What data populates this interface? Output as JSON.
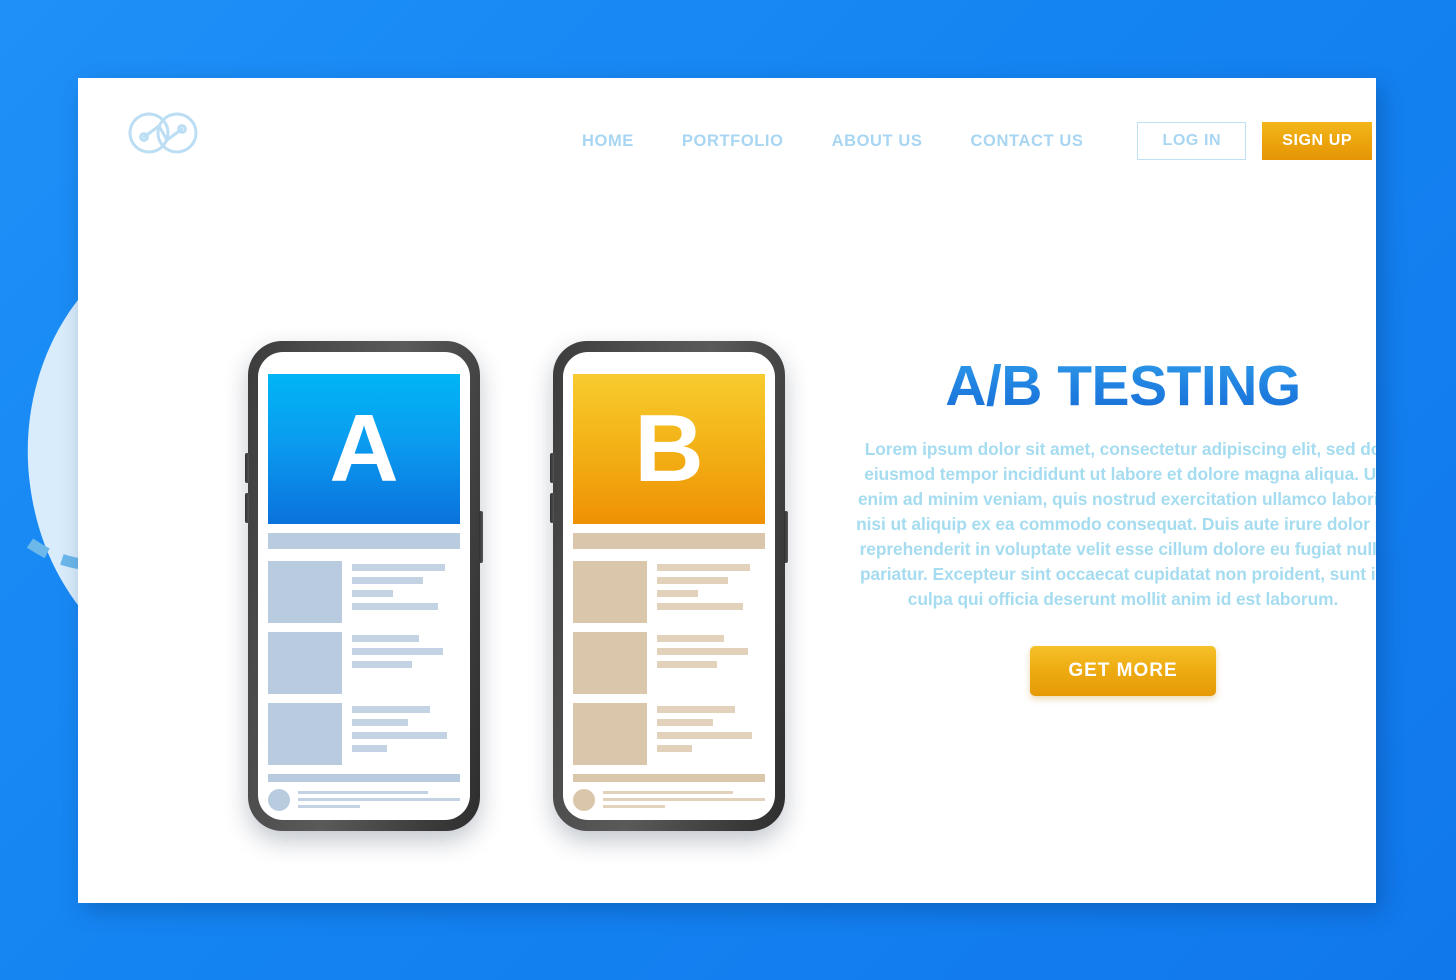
{
  "theme": {
    "page_background": "#1484f2",
    "card_background": "#ffffff",
    "accent_blue": "#1f7fe0",
    "accent_orange": "#eeab12",
    "nav_link_color": "#a8d6f2",
    "body_text_color": "#a6dcf0",
    "blob_color": "#e3f1fb",
    "dash_color": "#6cb8ea",
    "divider_color": "#12427e",
    "variant_a_color": "#0a9cf0",
    "variant_b_color": "#f3b418",
    "placeholder_a_color": "#b9cbdf",
    "placeholder_b_color": "#d9c6ab"
  },
  "header": {
    "logo_name": "infinity-logo",
    "nav": [
      {
        "label": "HOME"
      },
      {
        "label": "PORTFOLIO"
      },
      {
        "label": "ABOUT US"
      },
      {
        "label": "CONTACT US"
      }
    ],
    "login_label": "LOG IN",
    "signup_label": "SIGN UP"
  },
  "hero": {
    "title": "A/B TESTING",
    "paragraph": "Lorem ipsum dolor sit amet, consectetur adipiscing elit, sed do eiusmod tempor incididunt ut labore et dolore magna aliqua. Ut enim ad minim veniam, quis nostrud exercitation ullamco laboris nisi ut aliquip ex ea commodo consequat. Duis aute irure dolor in reprehenderit in voluptate velit esse cillum dolore eu fugiat nulla pariatur. Excepteur sint occaecat cupidatat non proident, sunt in culpa qui officia deserunt mollit anim id est laborum.",
    "cta_label": "GET MORE"
  },
  "illustration": {
    "variant_a": {
      "letter": "A",
      "content_rows": 3,
      "feed_rows": 3
    },
    "variant_b": {
      "letter": "B",
      "content_rows": 3,
      "feed_rows": 3
    }
  }
}
